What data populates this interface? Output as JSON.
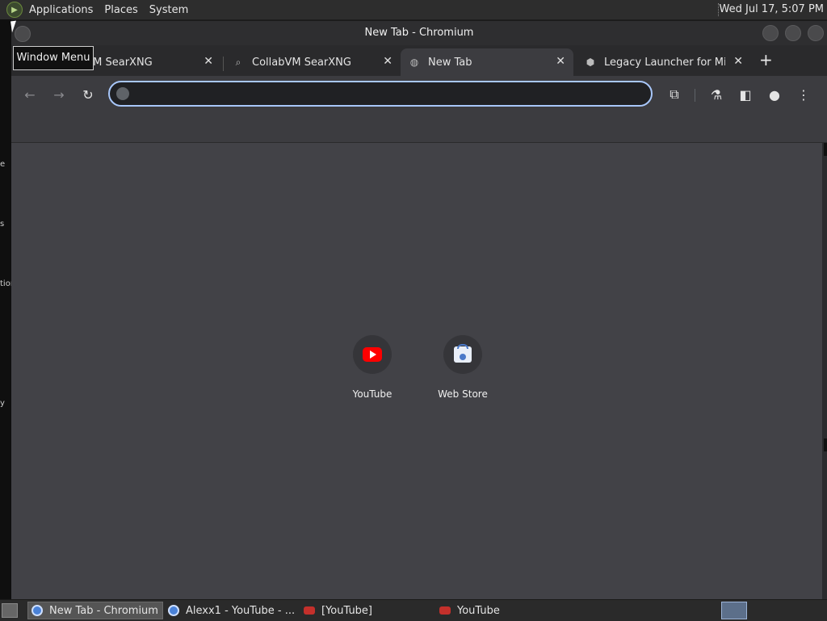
{
  "system_panel": {
    "menus": [
      "Applications",
      "Places",
      "System"
    ],
    "clock": "Wed Jul 17,  5:07 PM"
  },
  "desktop_strip": {
    "fragments": [
      "e",
      "s",
      "tion",
      "y"
    ]
  },
  "window": {
    "title": "New Tab - Chromium",
    "tooltip": "Window Menu"
  },
  "tabs": [
    {
      "title": "bVM SearXNG",
      "icon": "searxng-icon",
      "active": false
    },
    {
      "title": "CollabVM SearXNG",
      "icon": "searxng-icon",
      "active": false
    },
    {
      "title": "New Tab",
      "icon": "globe-icon",
      "active": true
    },
    {
      "title": "Legacy Launcher for Mine",
      "icon": "cube-icon",
      "active": false
    }
  ],
  "omnibox": {
    "value": "",
    "placeholder": ""
  },
  "shortcuts": [
    {
      "label": "YouTube",
      "icon": "youtube-icon"
    },
    {
      "label": "Web Store",
      "icon": "web-store-icon"
    }
  ],
  "taskbar": {
    "tasks": [
      {
        "title": "New Tab - Chromium",
        "icon": "chromium-icon",
        "active": true
      },
      {
        "title": "Alexx1 - YouTube - ...",
        "icon": "chromium-icon",
        "active": false
      },
      {
        "title": "[YouTube]",
        "icon": "youtube-icon",
        "active": false
      },
      {
        "title": "YouTube",
        "icon": "youtube-icon",
        "active": false
      }
    ]
  },
  "colors": {
    "accent_focus": "#a8c7fa",
    "content_bg": "#424247",
    "youtube_red": "#ff0000"
  }
}
